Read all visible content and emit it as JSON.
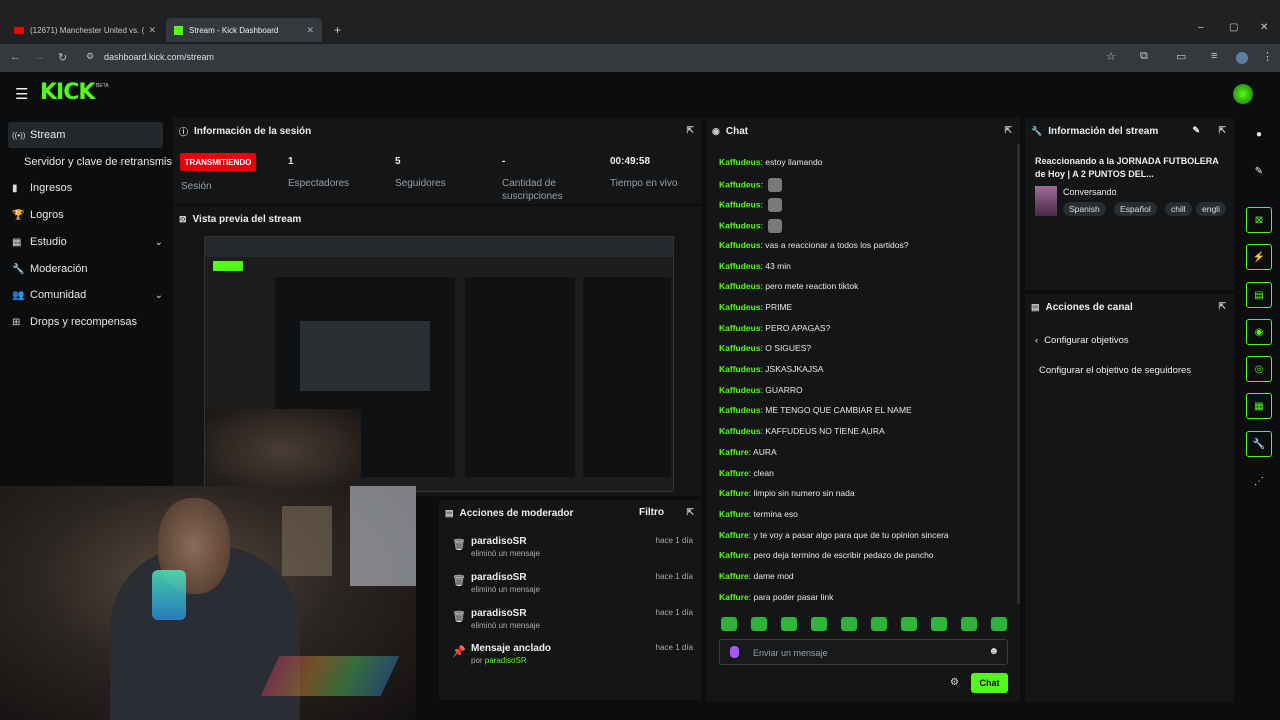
{
  "browser": {
    "tabs": [
      {
        "title": "(12671) Manchester United vs. (",
        "close": "✕"
      },
      {
        "title": "Stream - Kick Dashboard",
        "close": "✕"
      }
    ],
    "new_tab": "+",
    "url": "dashboard.kick.com/stream",
    "window_controls": {
      "minimize": "–",
      "maximize": "▢",
      "close": "✕"
    }
  },
  "app": {
    "logo": "KICK",
    "beta": "BETA",
    "menu_icon": "☰"
  },
  "sidebar": {
    "items": [
      {
        "label": "Stream",
        "icon": "broadcast-icon",
        "glyph": "((•))",
        "active": true
      },
      {
        "label": "Servidor y clave de retransmisi",
        "sub": true
      },
      {
        "label": "Ingresos",
        "icon": "chart-icon",
        "glyph": "▮"
      },
      {
        "label": "Logros",
        "icon": "trophy-icon",
        "glyph": "🏆"
      },
      {
        "label": "Estudio",
        "icon": "layout-icon",
        "glyph": "▦",
        "chevron": "⌄"
      },
      {
        "label": "Moderación",
        "icon": "wrench-icon",
        "glyph": "🔧"
      },
      {
        "label": "Comunidad",
        "icon": "people-icon",
        "glyph": "👥",
        "chevron": "⌄"
      },
      {
        "label": "Drops y recompensas",
        "icon": "gift-icon",
        "glyph": "⊞"
      }
    ]
  },
  "session": {
    "title": "Información de la sesión",
    "live_badge": "TRANSMITIENDO",
    "session_label": "Sesión",
    "stats": [
      {
        "value": "1",
        "label": "Espectadores"
      },
      {
        "value": "5",
        "label": "Seguidores"
      },
      {
        "value": "-",
        "label": "Cantidad de suscripciones"
      },
      {
        "value": "00:49:58",
        "label": "Tiempo en vivo"
      }
    ]
  },
  "preview": {
    "title": "Vista previa del stream"
  },
  "moderator": {
    "title": "Acciones de moderador",
    "filter": "Filtro",
    "items": [
      {
        "name": "paradisoSR",
        "desc": "eliminó un mensaje",
        "time": "hace 1 día",
        "icon": "trash-icon"
      },
      {
        "name": "paradisoSR",
        "desc": "eliminó un mensaje",
        "time": "hace 1 día",
        "icon": "trash-icon"
      },
      {
        "name": "paradisoSR",
        "desc": "eliminó un mensaje",
        "time": "hace 1 día",
        "icon": "trash-icon"
      },
      {
        "name": "Mensaje anclado",
        "desc_prefix": "por",
        "desc_user": "paradisoSR",
        "time": "hace 1 día",
        "icon": "pin-icon"
      }
    ]
  },
  "chat": {
    "title": "Chat",
    "messages": [
      {
        "user": "Kaffudeus",
        "text": "estoy llamando"
      },
      {
        "user": "Kaffudeus",
        "text": "",
        "emote": true
      },
      {
        "user": "Kaffudeus",
        "text": "",
        "emote": true
      },
      {
        "user": "Kaffudeus",
        "text": "",
        "emote": true
      },
      {
        "user": "Kaffudeus",
        "text": "vas a reaccionar a todos los partidos?"
      },
      {
        "user": "Kaffudeus",
        "text": "43 min"
      },
      {
        "user": "Kaffudeus",
        "text": "pero mete reaction tiktok"
      },
      {
        "user": "Kaffudeus",
        "text": "PRIME"
      },
      {
        "user": "Kaffudeus",
        "text": "PERO APAGAS?"
      },
      {
        "user": "Kaffudeus",
        "text": "O SIGUES?"
      },
      {
        "user": "Kaffudeus",
        "text": "JSKASJKAJSA"
      },
      {
        "user": "Kaffudeus",
        "text": "GUARRO"
      },
      {
        "user": "Kaffudeus",
        "text": "ME TENGO QUE CAMBIAR EL NAME"
      },
      {
        "user": "Kaffudeus",
        "text": "KAFFUDEUS NO TIENE AURA"
      },
      {
        "user": "Kaffure",
        "text": "AURA"
      },
      {
        "user": "Kaffure",
        "text": "clean"
      },
      {
        "user": "Kaffure",
        "text": "limpio sin numero sin nada"
      },
      {
        "user": "Kaffure",
        "text": "termina eso"
      },
      {
        "user": "Kaffure",
        "text": "y te voy a pasar algo para que de tu opinion sincera"
      },
      {
        "user": "Kaffure",
        "text": "pero deja termino de escribir pedazo de pancho"
      },
      {
        "user": "Kaffure",
        "text": "dame mod"
      },
      {
        "user": "Kaffure",
        "text": "para poder pasar link"
      }
    ],
    "input_placeholder": "Enviar un mensaje",
    "send_label": "Chat",
    "emote_count": 10
  },
  "stream_info": {
    "title": "Información del stream",
    "stream_title": "Reaccionando a la JORNADA FUTBOLERA de Hoy | A 2 PUNTOS DEL...",
    "category": "Conversando",
    "tags": [
      "Spanish",
      "Español",
      "chill",
      "engli"
    ]
  },
  "channel_actions": {
    "title": "Acciones de canal",
    "back_label": "Configurar objetivos",
    "item": "Configurar el objetivo de seguidores"
  },
  "rail": {
    "buttons": [
      "info-icon",
      "edit-icon",
      "target-icon",
      "bolt-icon",
      "document-icon",
      "chat-bubble-icon",
      "broadcast-icon",
      "layout-icon",
      "wrench-icon",
      "share-icon"
    ]
  },
  "colors": {
    "accent": "#53fc18",
    "live": "#e5000c",
    "panel": "#131516",
    "bg": "#0b0d0e"
  }
}
